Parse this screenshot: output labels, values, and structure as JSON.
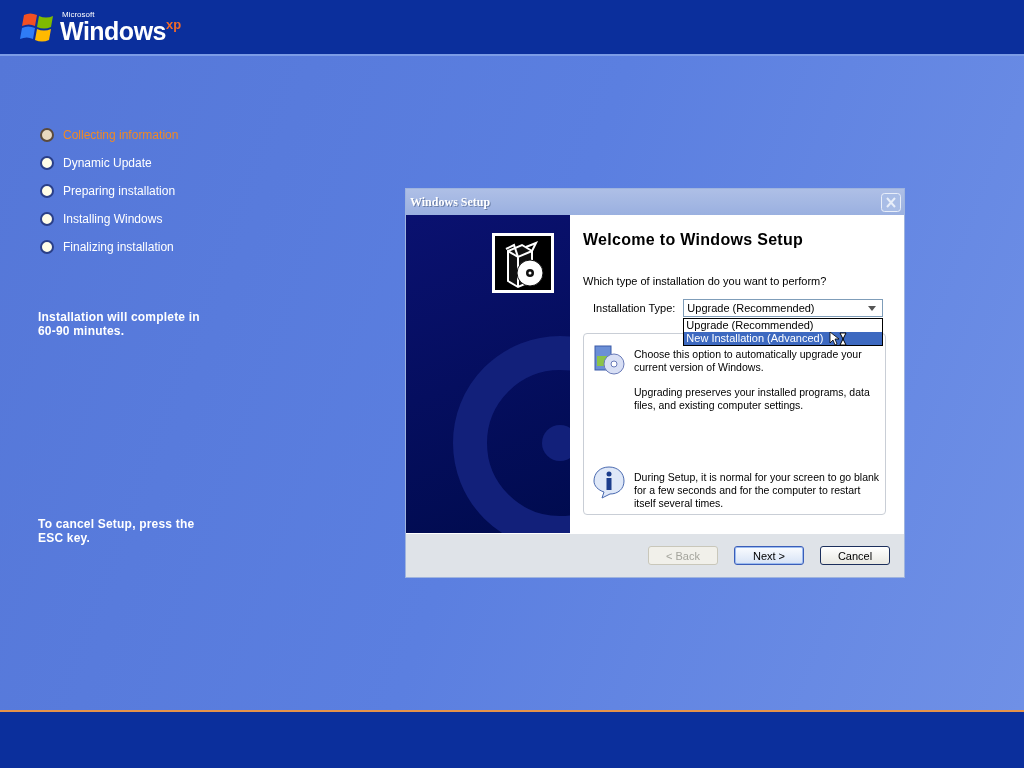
{
  "logo": {
    "company": "Microsoft",
    "product": "Windows",
    "edition": "xp"
  },
  "steps": [
    {
      "label": "Collecting information",
      "selected": true
    },
    {
      "label": "Dynamic Update",
      "selected": false
    },
    {
      "label": "Preparing installation",
      "selected": false
    },
    {
      "label": "Installing Windows",
      "selected": false
    },
    {
      "label": "Finalizing installation",
      "selected": false
    }
  ],
  "time_estimate": "Installation will complete in 60-90 minutes.",
  "cancel_hint": "To cancel Setup, press the ESC key.",
  "dialog": {
    "title": "Windows Setup",
    "heading": "Welcome to Windows Setup",
    "question": "Which type of installation do you want to perform?",
    "type_label": "Installation Type:",
    "combo": {
      "value": "Upgrade (Recommended)",
      "expanded": true,
      "options": [
        {
          "label": "Upgrade (Recommended)",
          "highlighted": false
        },
        {
          "label": "New Installation (Advanced)",
          "highlighted": true
        }
      ]
    },
    "notes": [
      {
        "kind": "upgrade",
        "paragraphs": [
          "Choose this option to automatically upgrade your current version of Windows.",
          "Upgrading preserves your installed programs, data files, and existing computer settings."
        ]
      },
      {
        "kind": "info",
        "paragraphs": [
          "During Setup, it is normal for your screen to go blank for a few seconds and for the computer to restart itself several times."
        ]
      }
    ],
    "buttons": [
      {
        "label": "< Back",
        "disabled": true,
        "default": false
      },
      {
        "label": "Next >",
        "disabled": false,
        "default": true
      },
      {
        "label": "Cancel",
        "disabled": false,
        "default": false
      }
    ]
  }
}
